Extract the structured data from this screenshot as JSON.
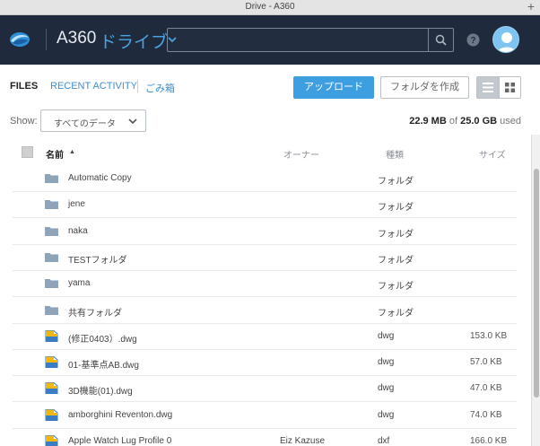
{
  "window": {
    "title": "Drive - A360",
    "new_tab_symbol": "+"
  },
  "colors": {
    "accent": "#3d9ee0",
    "header_bg": "#1f2a3c",
    "folder_icon": "#8fa3b8",
    "dwg_yellow": "#f1b90f",
    "dwg_blue": "#3b7dc4"
  },
  "header": {
    "logo_icon": "a360-swirl-logo-icon",
    "product": "A360",
    "section": "ドライブ",
    "search": {
      "placeholder": "",
      "value": "",
      "button_icon": "search-icon"
    },
    "help_icon": "help-icon",
    "avatar_icon": "user-avatar-icon"
  },
  "nav": {
    "tabs": [
      {
        "label": "FILES",
        "active": true
      },
      {
        "label": "RECENT ACTIVITY",
        "active": false
      },
      {
        "label": "ごみ箱",
        "active": false
      }
    ]
  },
  "actions": {
    "upload": "アップロード",
    "create_folder": "フォルダを作成"
  },
  "view_toggle": {
    "active": "list"
  },
  "filter": {
    "label": "Show:",
    "selected": "すべてのデータ"
  },
  "storage": {
    "used": "22.9 MB",
    "of": "of",
    "total": "25.0 GB",
    "suffix": "used"
  },
  "table": {
    "columns": {
      "name": "名前",
      "owner": "オーナー",
      "type": "種類",
      "size": "サイズ"
    },
    "sort_indicator": "▲",
    "rows": [
      {
        "name": "Automatic Copy",
        "owner": "",
        "type": "フォルダ",
        "size": "",
        "icon": "folder-icon"
      },
      {
        "name": "jene",
        "owner": "",
        "type": "フォルダ",
        "size": "",
        "icon": "folder-icon"
      },
      {
        "name": "naka",
        "owner": "",
        "type": "フォルダ",
        "size": "",
        "icon": "folder-icon"
      },
      {
        "name": "TESTフォルダ",
        "owner": "",
        "type": "フォルダ",
        "size": "",
        "icon": "folder-icon"
      },
      {
        "name": "yama",
        "owner": "",
        "type": "フォルダ",
        "size": "",
        "icon": "folder-icon"
      },
      {
        "name": "共有フォルダ",
        "owner": "",
        "type": "フォルダ",
        "size": "",
        "icon": "folder-icon"
      },
      {
        "name": "(修正0403）.dwg",
        "owner": "",
        "type": "dwg",
        "size": "153.0 KB",
        "icon": "dwg-file-icon"
      },
      {
        "name": "01-基準点AB.dwg",
        "owner": "",
        "type": "dwg",
        "size": "57.0 KB",
        "icon": "dwg-file-icon"
      },
      {
        "name": "3D機能(01).dwg",
        "owner": "",
        "type": "dwg",
        "size": "47.0 KB",
        "icon": "dwg-file-icon"
      },
      {
        "name": "amborghini Reventon.dwg",
        "owner": "",
        "type": "dwg",
        "size": "74.0 KB",
        "icon": "dwg-file-icon"
      },
      {
        "name": "Apple Watch Lug Profile 0",
        "owner": "Eiz Kazuse",
        "type": "dxf",
        "size": "166.0 KB",
        "icon": "dwg-file-icon"
      }
    ]
  }
}
